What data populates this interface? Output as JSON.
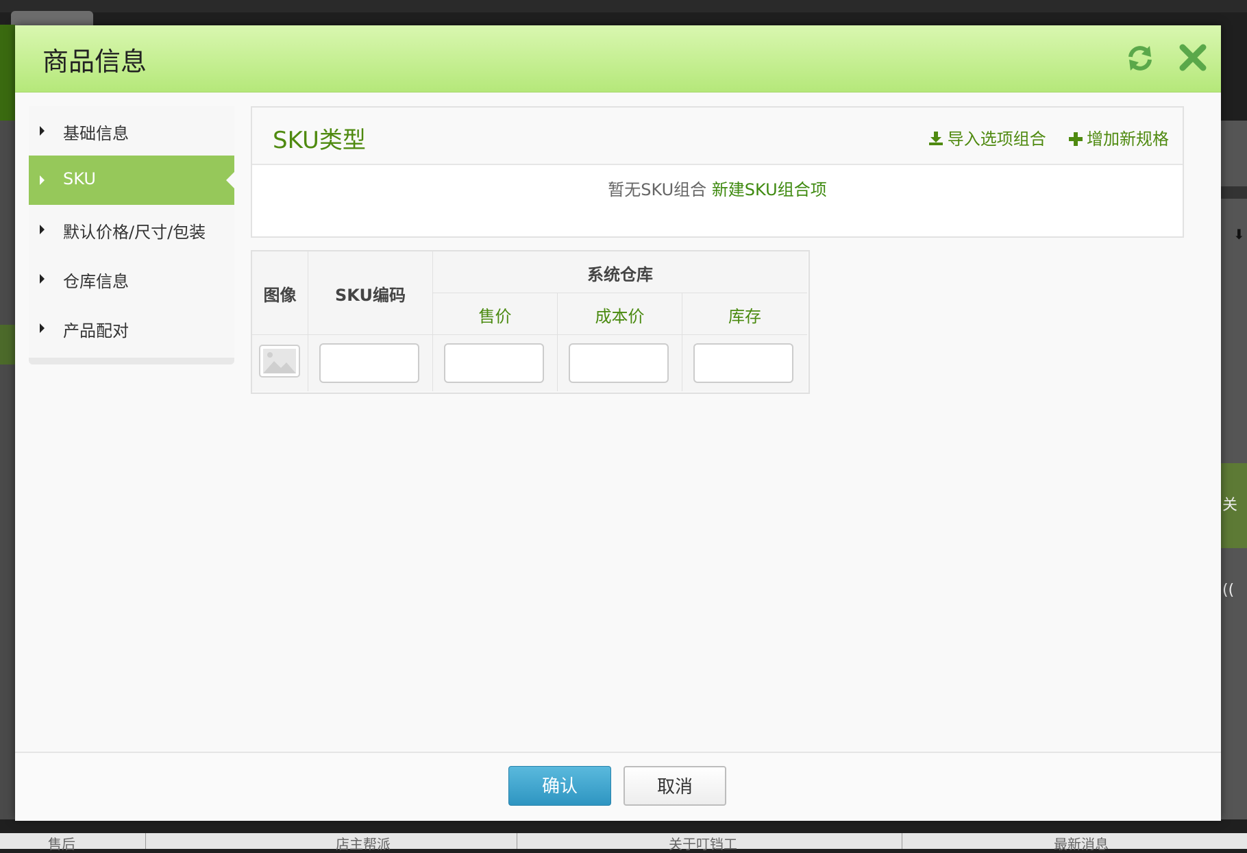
{
  "background": {
    "bottom_bar": [
      "售后",
      "店主帮派",
      "关于叮铛工",
      "最新消息"
    ],
    "right_edge_text": "关(("
  },
  "modal": {
    "title": "商品信息",
    "header_icons": [
      "refresh-icon",
      "close-icon"
    ],
    "accent_color": "#96c85a"
  },
  "sidebar": {
    "items": [
      {
        "label": "基础信息",
        "active": false
      },
      {
        "label": "SKU",
        "active": true
      },
      {
        "label": "默认价格/尺寸/包装",
        "active": false
      },
      {
        "label": "仓库信息",
        "active": false
      },
      {
        "label": "产品配对",
        "active": false
      }
    ]
  },
  "sku_type": {
    "title": "SKU类型",
    "import_label": "导入选项组合",
    "add_label": "增加新规格",
    "empty_text": "暂无SKU组合",
    "create_link": "新建SKU组合项"
  },
  "sku_table": {
    "col_image": "图像",
    "col_code": "SKU编码",
    "group_header": "系统仓库",
    "sub_headers": [
      "售价",
      "成本价",
      "库存"
    ],
    "row": {
      "code": "",
      "price": "",
      "cost": "",
      "stock": ""
    }
  },
  "footer": {
    "confirm_label": "确认",
    "cancel_label": "取消"
  }
}
